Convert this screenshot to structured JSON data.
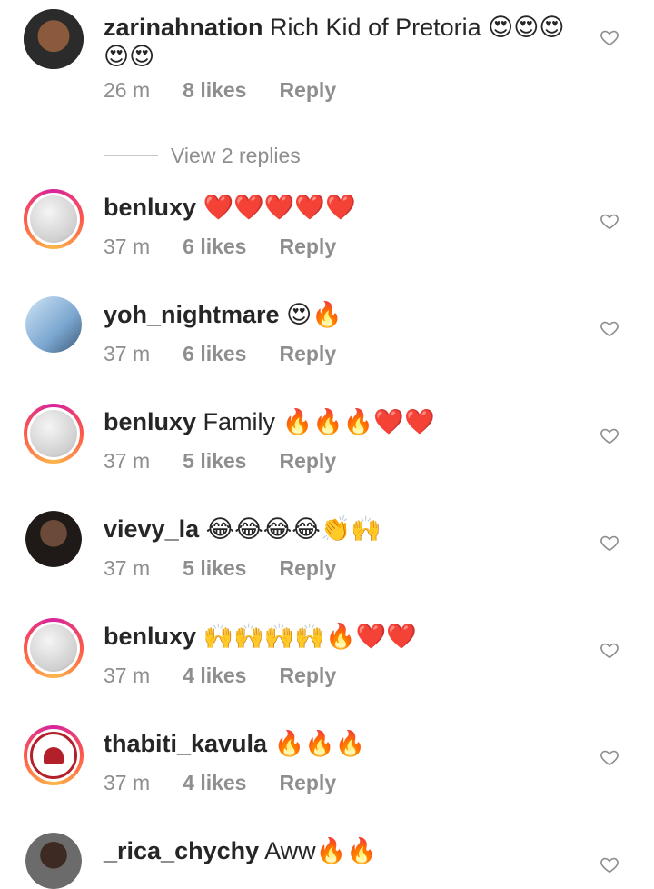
{
  "comments": [
    {
      "username": "zarinahnation",
      "text": "Rich Kid of Pretoria 😍😍😍😍😍",
      "time": "26 m",
      "likes": "8 likes",
      "reply": "Reply",
      "avatar": "profile-photo",
      "view_replies": "View 2 replies"
    },
    {
      "username": "benluxy",
      "text": "❤️❤️❤️❤️❤️",
      "time": "37 m",
      "likes": "6 likes",
      "reply": "Reply",
      "avatar": "smiley-face"
    },
    {
      "username": "yoh_nightmare",
      "text": "😍🔥",
      "time": "37 m",
      "likes": "6 likes",
      "reply": "Reply",
      "avatar": "profile-photo"
    },
    {
      "username": "benluxy",
      "text": "Family 🔥🔥🔥❤️❤️",
      "time": "37 m",
      "likes": "5 likes",
      "reply": "Reply",
      "avatar": "smiley-face"
    },
    {
      "username": "vievy_la",
      "text": "😂😂😂😂👏🙌",
      "time": "37 m",
      "likes": "5 likes",
      "reply": "Reply",
      "avatar": "profile-photo"
    },
    {
      "username": "benluxy",
      "text": "🙌🙌🙌🙌🔥❤️❤️",
      "time": "37 m",
      "likes": "4 likes",
      "reply": "Reply",
      "avatar": "smiley-face"
    },
    {
      "username": "thabiti_kavula",
      "text": "🔥🔥🔥",
      "time": "37 m",
      "likes": "4 likes",
      "reply": "Reply",
      "avatar": "logo"
    },
    {
      "username": "_rica_chychy",
      "text": "Aww🔥🔥",
      "time": "",
      "likes": "",
      "reply": "",
      "avatar": "profile-photo"
    }
  ],
  "icons": {
    "like": "heart-outline-icon"
  },
  "colors": {
    "muted": "#8e8e8e",
    "text": "#262626",
    "story_ring_start": "#d6249f",
    "story_ring_end": "#fdb64a"
  }
}
